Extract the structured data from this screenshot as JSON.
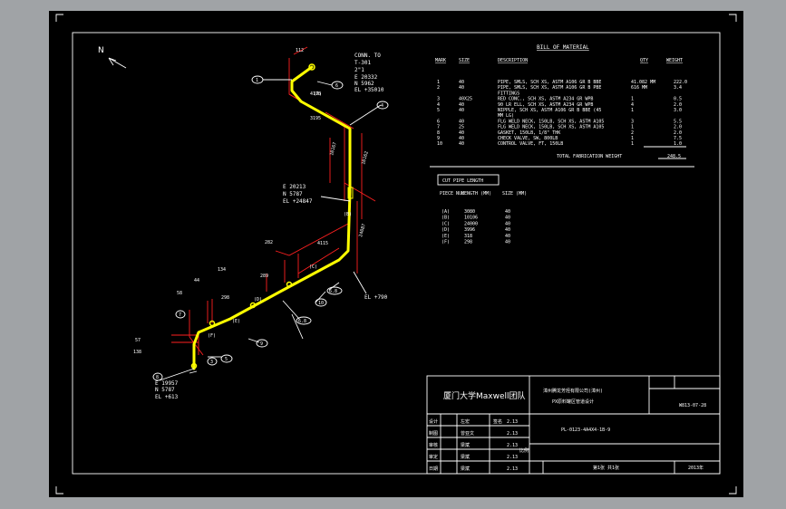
{
  "north_label": "N",
  "colors": {
    "pipe": "#ffff00",
    "dim": "#ff2020",
    "line": "#ffffff",
    "bg": "#000000"
  },
  "iso": {
    "conn": {
      "line1": "CONN. TO",
      "line2": "T-301",
      "line3": "2\"1",
      "line4": "E 20332",
      "line5": "N 5962",
      "line6": "EL +35010"
    },
    "mid_coord": {
      "line1": "E 20213",
      "line2": "N 5787",
      "line3": "EL +24847"
    },
    "bot_coord": {
      "line1": "E 19957",
      "line2": "N 5787",
      "line3": "EL +613"
    },
    "el_bottom": "EL +790",
    "dims": {
      "d112": "112",
      "d3195": "3195",
      "d10167": "10167",
      "d10162": "10162",
      "d24087": "24087",
      "d4115": "4115",
      "d282": "282",
      "d134": "134",
      "d44": "44",
      "d58": "58",
      "d57": "57",
      "d138": "138",
      "d289": "289",
      "d298": "298"
    },
    "balloons": [
      "1",
      "2",
      "3",
      "4",
      "5",
      "6",
      "7",
      "8",
      "9",
      "10",
      "6.8",
      "6.8"
    ],
    "cut_marks": [
      "(A)",
      "(B)",
      "(C)",
      "(D)",
      "(E)",
      "(F)"
    ]
  },
  "bom": {
    "title": "BILL OF MATERIAL",
    "headers": [
      "MARK",
      "SIZE",
      "DESCRIPTION",
      "QTY",
      "WEIGHT"
    ],
    "rows": [
      {
        "mark": "1",
        "size": "40",
        "desc": "PIPE, SMLS, SCH XS, ASTM A106 GR B BBE",
        "qty": "41.082 MM",
        "wt": "222.0"
      },
      {
        "mark": "2",
        "size": "40",
        "desc": "PIPE, SMLS, SCH XS, ASTM A106 GR B PBE",
        "qty": "616 MM",
        "wt": "3.4"
      },
      {
        "mark": "",
        "size": "",
        "desc": "FITTINGS",
        "qty": "",
        "wt": ""
      },
      {
        "mark": "3",
        "size": "40X25",
        "desc": "RED CONC., SCH XS, ASTM A234 GR WPB",
        "qty": "1",
        "wt": "0.5"
      },
      {
        "mark": "4",
        "size": "40",
        "desc": "90 LR ELL, SCH XS, ASTM A234 GR WPB",
        "qty": "4",
        "wt": "2.0"
      },
      {
        "mark": "5",
        "size": "40",
        "desc": "NIPPLE, SCH XS, ASTM A106 GR B BBE (45",
        "qty": "1",
        "wt": "3.0"
      },
      {
        "mark": "",
        "size": "",
        "desc": "MM LG)",
        "qty": "",
        "wt": ""
      },
      {
        "mark": "6",
        "size": "40",
        "desc": "FLG WELD NECK, 150LB, SCH XS, ASTM A105",
        "qty": "3",
        "wt": "5.5"
      },
      {
        "mark": "7",
        "size": "25",
        "desc": "FLG WELD NECK, 150LB, SCH XS, ASTM A105",
        "qty": "1",
        "wt": "2.0"
      },
      {
        "mark": "8",
        "size": "40",
        "desc": "GASKET, 150LB, 1/8\" THK",
        "qty": "2",
        "wt": "2.0"
      },
      {
        "mark": "9",
        "size": "40",
        "desc": "CHECK VALVE, SW, 800LB",
        "qty": "1",
        "wt": "7.5"
      },
      {
        "mark": "10",
        "size": "40",
        "desc": "CONTROL VALVE, FT, 150LB",
        "qty": "1",
        "wt": "1.0"
      }
    ],
    "total_label": "TOTAL FABRICATION WEIGHT",
    "total_value": "248.5"
  },
  "cut": {
    "title": "CUT PIPE LENGTH",
    "headers": [
      "PIECE NUM",
      "LENGTH (MM)",
      "SIZE (MM)"
    ],
    "rows": [
      {
        "piece": "(A)",
        "length": "3080",
        "size": "40"
      },
      {
        "piece": "(B)",
        "length": "10106",
        "size": "40"
      },
      {
        "piece": "(C)",
        "length": "24000",
        "size": "40"
      },
      {
        "piece": "(D)",
        "length": "3996",
        "size": "40"
      },
      {
        "piece": "(E)",
        "length": "318",
        "size": "40"
      },
      {
        "piece": "(F)",
        "length": "298",
        "size": "40"
      }
    ]
  },
  "titleblock": {
    "team": "厦门大学Maxwell团队",
    "project_line1": "漳州腾龙芳烃有限公司(漳州)",
    "project_line2": "PX原料罐区管道设计",
    "drawing_no": "W813-07-28",
    "small_code1": "",
    "small_code2": "",
    "row_labels": [
      "设计",
      "制图",
      "审核",
      "审定",
      "日期"
    ],
    "row_names": [
      "左宏",
      "曾亚文",
      "梁斌",
      "梁斌",
      "梁斌"
    ],
    "row_sign": [
      "签名",
      "",
      "",
      "",
      ""
    ],
    "row_dates": [
      "2.13",
      "2.13",
      "2.13",
      "2.13",
      "2.13"
    ],
    "mid_text": "PL-0123-4A4X4-1B-9",
    "scale_label": "比例",
    "sheet_text": "第1张 共1张",
    "year_text": "2013年"
  }
}
